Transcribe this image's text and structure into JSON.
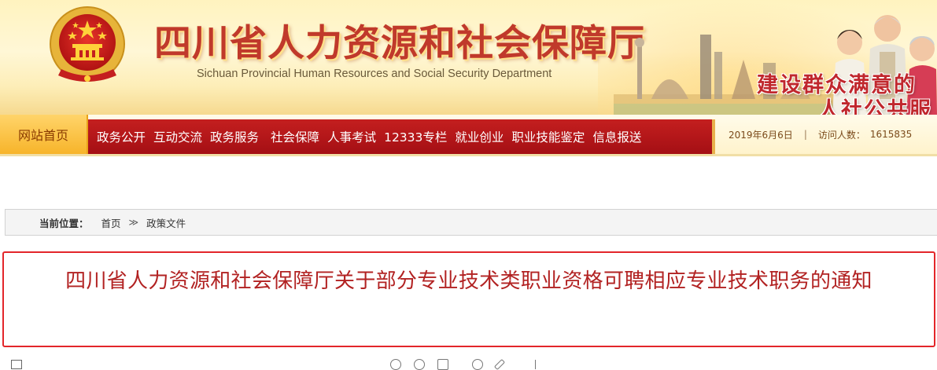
{
  "header": {
    "title_cn": "四川省人力资源和社会保障厅",
    "title_en": "Sichuan Provincial Human Resources and Social Security Department",
    "slogan_line1": "建设群众满意的",
    "slogan_line2": "人社公共服",
    "accent_color": "#c0392b"
  },
  "nav": {
    "home_label": "网站首页",
    "items": [
      "政务公开",
      "互动交流",
      "政务服务",
      "社会保障",
      "人事考试",
      "12333专栏",
      "就业创业",
      "职业技能鉴定",
      "信息报送"
    ],
    "bar_color": "#b3161b"
  },
  "status": {
    "date": "2019年6月6日",
    "separator": "|",
    "visitors_label": "访问人数：",
    "visitors_count": "1615835"
  },
  "breadcrumb": {
    "label": "当前位置：",
    "home": "首页",
    "arrow": "≫",
    "current": "政策文件"
  },
  "article": {
    "title": "四川省人力资源和社会保障厅关于部分专业技术类职业资格可聘相应专业技术职务的通知"
  }
}
